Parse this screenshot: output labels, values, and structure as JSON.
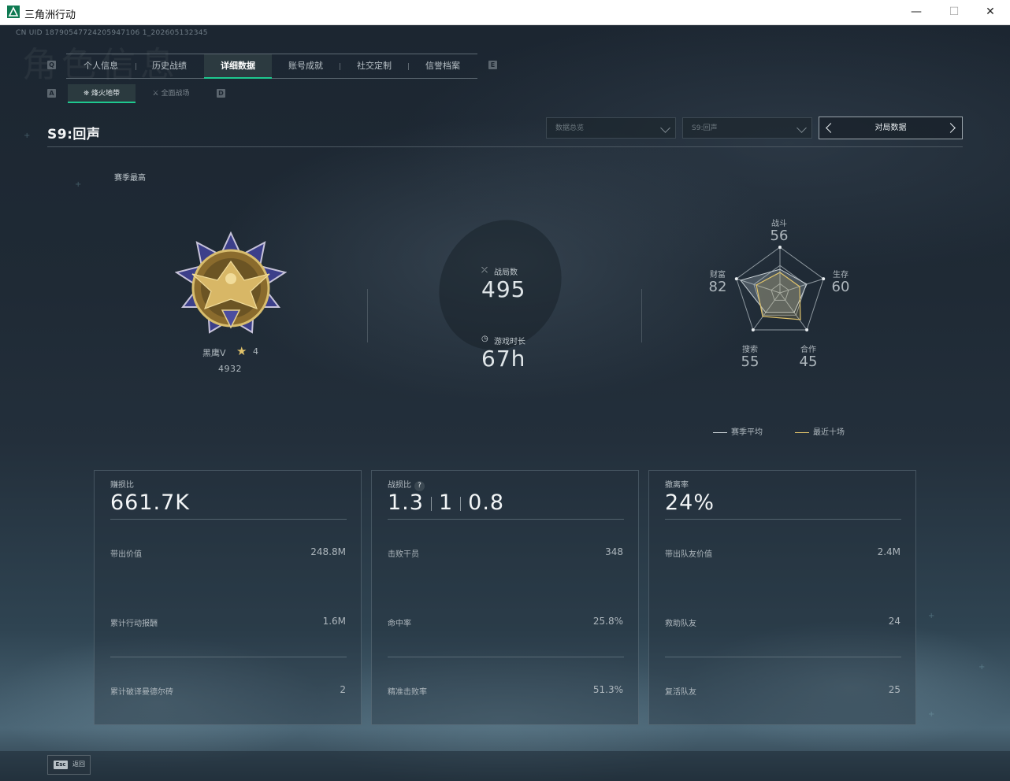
{
  "window": {
    "title": "三角洲行动",
    "minimize": "—",
    "maximize": "☐",
    "close": "✕"
  },
  "header": {
    "uid": "CN UID 18790547724205947106 1_202605132345",
    "watermark": "角色信息"
  },
  "main_tabs": {
    "left_key": "Q",
    "right_key": "E",
    "items": [
      {
        "label": "个人信息"
      },
      {
        "label": "历史战绩"
      },
      {
        "label": "详细数据",
        "active": true
      },
      {
        "label": "账号成就"
      },
      {
        "label": "社交定制"
      },
      {
        "label": "信誉档案"
      }
    ]
  },
  "sub_tabs": {
    "left_key": "A",
    "right_key": "D",
    "items": [
      {
        "label": "烽火地带",
        "active": true
      },
      {
        "label": "全面战场"
      }
    ]
  },
  "season": {
    "title": "S9:回声",
    "best_label": "赛季最高"
  },
  "filters": {
    "data_type": "数据总览",
    "season": "S9:回声",
    "pager_label": "对局数据"
  },
  "rank": {
    "name": "黑鹰V",
    "stars": "4",
    "score": "4932"
  },
  "summary": {
    "matches_label": "战局数",
    "matches_value": "495",
    "playtime_label": "游戏时长",
    "playtime_value": "67h"
  },
  "radar": {
    "labels": {
      "combat": "战斗",
      "survival": "生存",
      "cooperation": "合作",
      "search": "搜索",
      "wealth": "财富"
    },
    "values": {
      "combat": "56",
      "survival": "60",
      "cooperation": "45",
      "search": "55",
      "wealth": "82"
    },
    "legend": {
      "season_avg": "赛季平均",
      "recent_ten": "最近十场"
    },
    "colors": {
      "season_avg": "#c9d1d6",
      "recent_ten": "#e0c36b"
    }
  },
  "cards": [
    {
      "title": "赚损比",
      "big": "661.7K",
      "rows": [
        {
          "label": "带出价值",
          "value": "248.8M"
        },
        {
          "label": "累计行动报酬",
          "value": "1.6M"
        },
        {
          "label": "累计破译曼德尔砖",
          "value": "2"
        }
      ]
    },
    {
      "title": "战损比",
      "help": "?",
      "ratios": [
        "1.3",
        "1",
        "0.8"
      ],
      "rows": [
        {
          "label": "击败干员",
          "value": "348"
        },
        {
          "label": "命中率",
          "value": "25.8%"
        },
        {
          "label": "精准击败率",
          "value": "51.3%"
        }
      ]
    },
    {
      "title": "撤离率",
      "big": "24%",
      "rows": [
        {
          "label": "带出队友价值",
          "value": "2.4M"
        },
        {
          "label": "救助队友",
          "value": "24"
        },
        {
          "label": "复活队友",
          "value": "25"
        }
      ]
    }
  ],
  "footer": {
    "esc_key": "Esc",
    "esc_label": "返回"
  },
  "colors": {
    "accent": "#1ec98f",
    "gold": "#e0c36b"
  }
}
